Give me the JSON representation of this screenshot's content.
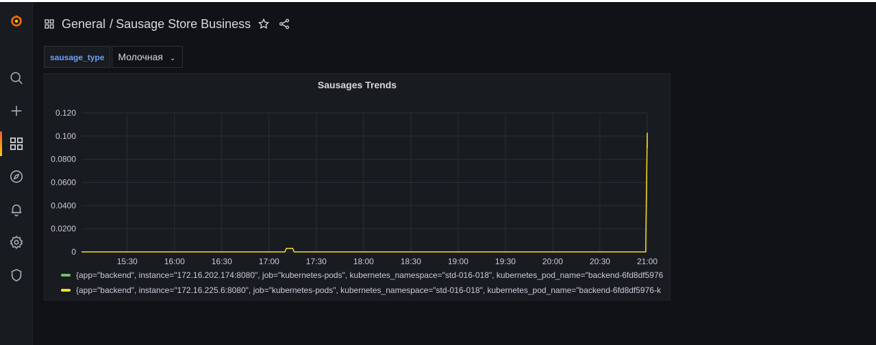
{
  "breadcrumb": {
    "folder": "General",
    "separator": "/",
    "dashboard": "Sausage Store Business"
  },
  "variable": {
    "name": "sausage_type",
    "value": "Молочная"
  },
  "panel": {
    "title": "Sausages Trends"
  },
  "colors": {
    "series_green": "#73bf69",
    "series_yellow": "#fade2a",
    "link_blue": "#6e9fff",
    "background": "#111217",
    "panel_bg": "#181b1f"
  },
  "sidebar": {
    "items": [
      {
        "icon": "grafana-logo-icon"
      },
      {
        "icon": "search-icon"
      },
      {
        "icon": "plus-icon"
      },
      {
        "icon": "dashboards-icon",
        "active": true
      },
      {
        "icon": "explore-compass-icon"
      },
      {
        "icon": "alerting-bell-icon"
      },
      {
        "icon": "configuration-gear-icon"
      },
      {
        "icon": "server-admin-shield-icon"
      }
    ]
  },
  "chart_data": {
    "type": "line",
    "title": "Sausages Trends",
    "x_ticks": [
      "15:30",
      "16:00",
      "16:30",
      "17:00",
      "17:30",
      "18:00",
      "18:30",
      "19:00",
      "19:30",
      "20:00",
      "20:30",
      "21:00"
    ],
    "y_ticks": [
      "0",
      "0.0200",
      "0.0400",
      "0.0600",
      "0.0800",
      "0.100",
      "0.120"
    ],
    "y_tick_values": [
      0,
      0.02,
      0.04,
      0.06,
      0.08,
      0.1,
      0.12
    ],
    "ylim": [
      0,
      0.12
    ],
    "xlim": [
      "15:01",
      "21:00"
    ],
    "grid": true,
    "legend_placement": "bottom",
    "series": [
      {
        "name": "{app=\"backend\", instance=\"172.16.202.174:8080\", job=\"kubernetes-pods\", kubernetes_namespace=\"std-016-018\", kubernetes_pod_name=\"backend-6fd8df5976",
        "color": "#73bf69",
        "points": []
      },
      {
        "name": "{app=\"backend\", instance=\"172.16.225.6:8080\", job=\"kubernetes-pods\", kubernetes_namespace=\"std-016-018\", kubernetes_pod_name=\"backend-6fd8df5976-k",
        "color": "#fade2a",
        "points": [
          [
            "15:01",
            0
          ],
          [
            "17:10",
            0
          ],
          [
            "17:11",
            0.003
          ],
          [
            "17:15",
            0.003
          ],
          [
            "17:16",
            0
          ],
          [
            "20:59",
            0
          ],
          [
            "21:00",
            0.103
          ],
          [
            "21:00",
            0.09
          ]
        ]
      }
    ]
  }
}
